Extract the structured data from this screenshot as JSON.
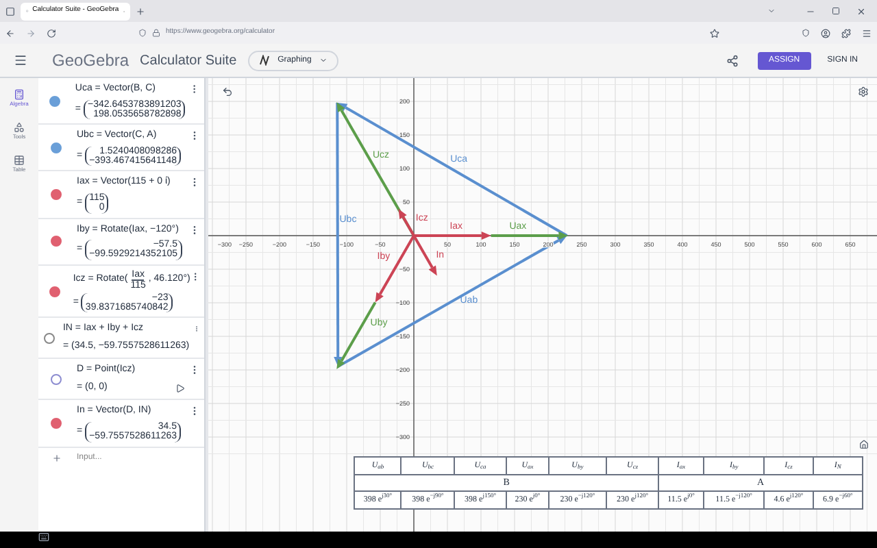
{
  "browser": {
    "tab_title": "Calculator Suite - GeoGebra",
    "url": "https://www.geogebra.org/calculator"
  },
  "header": {
    "logo": "GeoGebra",
    "title": "Calculator Suite",
    "app_menu": "Graphing",
    "assign": "ASSIGN",
    "sign_in": "SIGN IN"
  },
  "rail": [
    {
      "label": "Algebra",
      "selected": true
    },
    {
      "label": "Tools",
      "selected": false
    },
    {
      "label": "Table",
      "selected": false
    }
  ],
  "algebra": {
    "items": [
      {
        "kind": "matrix",
        "definition": "Uca = Vector(B, C)",
        "values": [
          "−342.6453783891203",
          "198.0535658782898"
        ],
        "color": "#6a9fd8",
        "shown": true
      },
      {
        "kind": "matrix",
        "definition": "Ubc = Vector(C, A)",
        "values": [
          "1.5240408098286",
          "−393.467415641148"
        ],
        "color": "#6a9fd8",
        "shown": true
      },
      {
        "kind": "matrix",
        "definition": "Iax = Vector(115 + 0 ί)",
        "values": [
          "115",
          "0"
        ],
        "color": "#e06070",
        "shown": true
      },
      {
        "kind": "matrix",
        "definition": "Iby = Rotate(Iax, −120°)",
        "values": [
          "−57.5",
          "−99.5929214352105"
        ],
        "color": "#e06070",
        "shown": true
      },
      {
        "kind": "fraction",
        "definition": "Icz = Rotate(",
        "numerator": "Iax",
        "denominator": "115",
        "definition_end": ", 46.120°)",
        "values": [
          "−23",
          "39.8371685740842"
        ],
        "color": "#e06070",
        "shown": true
      },
      {
        "kind": "point",
        "definition": "IN = Iax + Iby + Icz",
        "value": "= (34.5, −59.7557528611263)",
        "color": "#888888",
        "shown": false
      },
      {
        "kind": "point",
        "definition": "D = Point(Icz)",
        "value": "= (0, 0)",
        "color": "#8c8cd0",
        "shown": false,
        "play": true
      },
      {
        "kind": "matrix",
        "definition": "In = Vector(D, IN)",
        "values": [
          "34.5",
          "−59.7557528611263"
        ],
        "color": "#e06070",
        "shown": true
      }
    ],
    "equals": "=",
    "input_placeholder": "Input..."
  },
  "graph": {
    "x_ticks": [
      "−300",
      "−250",
      "−200",
      "−150",
      "−100",
      "−50",
      "50",
      "100",
      "150",
      "200",
      "250",
      "300",
      "350",
      "400",
      "450",
      "500",
      "550",
      "600",
      "650"
    ],
    "y_ticks": [
      "200",
      "150",
      "100",
      "50",
      "−50",
      "−100",
      "−150",
      "−200",
      "−250",
      "−300"
    ],
    "vectors": [
      {
        "label": "Uca",
        "color": "#5a8fcf"
      },
      {
        "label": "Ubc",
        "color": "#5a8fcf"
      },
      {
        "label": "Uab",
        "color": "#5a8fcf"
      },
      {
        "label": "Ucz",
        "color": "#5c9e4a"
      },
      {
        "label": "Uax",
        "color": "#5c9e4a"
      },
      {
        "label": "Uby",
        "color": "#5c9e4a"
      },
      {
        "label": "Iax",
        "color": "#cc4455"
      },
      {
        "label": "Iby",
        "color": "#cc4455"
      },
      {
        "label": "Icz",
        "color": "#cc4455"
      },
      {
        "label": "In",
        "color": "#cc4455"
      }
    ]
  },
  "table": {
    "headers": [
      "U$_{ab}$",
      "U$_{bc}$",
      "U$_{ca}$",
      "U$_{ax}$",
      "U$_{by}$",
      "U$_{cz}$",
      "I$_{ax}$",
      "I$_{by}$",
      "I$_{cz}$",
      "I$_{N}$"
    ],
    "groups": [
      {
        "label": "B"
      },
      {
        "label": "A"
      }
    ],
    "values": [
      "398 e$^{j30°}$",
      "398 e$^{−j90°}$",
      "398 e$^{j150°}$",
      "230 e$^{j0°}$",
      "230 e$^{−j120°}$",
      "230 e$^{j120°}$",
      "11.5 e$^{j0°}$",
      "11.5 e$^{−j120°}$",
      "4.6 e$^{j120°}$",
      "6.9 e$^{−j60°}$"
    ]
  }
}
